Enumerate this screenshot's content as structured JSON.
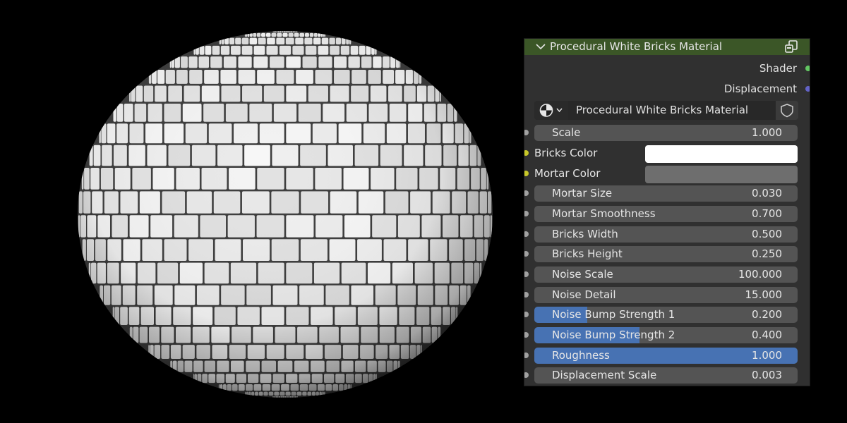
{
  "node": {
    "title": "Procedural White Bricks Material",
    "header_color": "#3b5627",
    "outputs": [
      {
        "label": "Shader",
        "socket_color": "#63c763"
      },
      {
        "label": "Displacement",
        "socket_color": "#6363c7"
      }
    ],
    "datablock": {
      "type_icon": "node-tree-icon",
      "name": "Procedural White Bricks Material",
      "fake_user_icon": "shield-icon"
    },
    "inputs": {
      "scale": {
        "label": "Scale",
        "value": "1.000"
      },
      "bricks_color": {
        "label": "Bricks Color",
        "color": "#ffffff"
      },
      "mortar_color": {
        "label": "Mortar Color",
        "color": "#6e6e6e"
      },
      "mortar_size": {
        "label": "Mortar Size",
        "value": "0.030"
      },
      "mortar_smoothness": {
        "label": "Mortar Smoothness",
        "value": "0.700"
      },
      "bricks_width": {
        "label": "Bricks Width",
        "value": "0.500"
      },
      "bricks_height": {
        "label": "Bricks Height",
        "value": "0.250"
      },
      "noise_scale": {
        "label": "Noise Scale",
        "value": "100.000"
      },
      "noise_detail": {
        "label": "Noise Detail",
        "value": "15.000"
      },
      "noise_bump_1": {
        "label": "Noise Bump Strength 1",
        "value": "0.200",
        "fill": 0.2
      },
      "noise_bump_2": {
        "label": "Noise Bump Strength 2",
        "value": "0.400",
        "fill": 0.4
      },
      "roughness": {
        "label": "Roughness",
        "value": "1.000",
        "fill": 1.0
      },
      "displacement_scale": {
        "label": "Displacement Scale",
        "value": "0.003"
      }
    }
  },
  "colors": {
    "panel_bg": "#303030",
    "field_bg": "#545454",
    "slider_fill": "#4772b3",
    "socket_gray": "#a1a1a1",
    "socket_yellow": "#c7c729"
  }
}
